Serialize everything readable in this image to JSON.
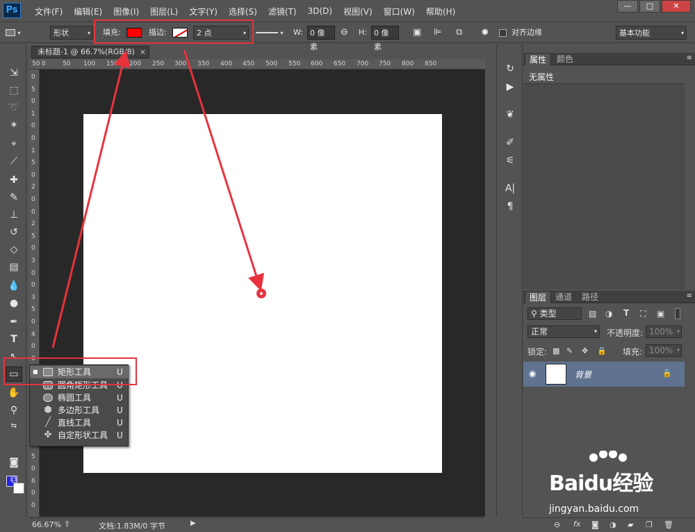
{
  "app": {
    "logo": "Ps"
  },
  "menu": [
    "文件(F)",
    "编辑(E)",
    "图像(I)",
    "图层(L)",
    "文字(Y)",
    "选择(S)",
    "滤镜(T)",
    "3D(D)",
    "视图(V)",
    "窗口(W)",
    "帮助(H)"
  ],
  "window_controls": {
    "minimize": "—",
    "maximize": "□",
    "close": "✕"
  },
  "options_bar": {
    "mode": "形状",
    "fill_label": "填充:",
    "fill_color": "#ff0000",
    "stroke_label": "描边:",
    "stroke_width": "2 点",
    "w_label": "W:",
    "w_value": "0 像素",
    "h_label": "H:",
    "h_value": "0 像素",
    "align_edges": "对齐边缘",
    "workspace": "基本功能"
  },
  "document": {
    "tab_title": "未标题-1 @ 66.7%(RGB/8)",
    "tab_close": "×",
    "ruler_top": [
      "50",
      "0",
      "50",
      "100",
      "150",
      "200",
      "250",
      "300",
      "350",
      "400",
      "450",
      "500",
      "550",
      "600",
      "650",
      "700",
      "750",
      "800",
      "850"
    ],
    "ruler_left": [
      "0",
      "5",
      "0",
      "1",
      "0",
      "0",
      "1",
      "5",
      "0",
      "2",
      "0",
      "0",
      "2",
      "5",
      "0",
      "3",
      "0",
      "0",
      "3",
      "5",
      "0",
      "4",
      "0",
      "0",
      "4",
      "5",
      "0",
      "5",
      "0",
      "0",
      "5",
      "5",
      "0",
      "6",
      "0",
      "0"
    ],
    "zoom": "66.67%",
    "doc_info": "文档:1.83M/0 字节"
  },
  "colors": {
    "foreground": "#2424e0",
    "background": "#ffffff",
    "annotation": "#e8323c"
  },
  "shape_flyout": [
    {
      "label": "矩形工具",
      "key": "U",
      "icon": "rectangle-icon",
      "selected": true
    },
    {
      "label": "圆角矩形工具",
      "key": "U",
      "icon": "rounded-rectangle-icon",
      "selected": false
    },
    {
      "label": "椭圆工具",
      "key": "U",
      "icon": "ellipse-icon",
      "selected": false
    },
    {
      "label": "多边形工具",
      "key": "U",
      "icon": "polygon-icon",
      "selected": false
    },
    {
      "label": "直线工具",
      "key": "U",
      "icon": "line-icon",
      "selected": false
    },
    {
      "label": "自定形状工具",
      "key": "U",
      "icon": "custom-shape-icon",
      "selected": false
    }
  ],
  "properties_panel": {
    "tabs": [
      "属性",
      "颜色"
    ],
    "no_properties": "无属性"
  },
  "layers_panel": {
    "tabs": [
      "图层",
      "通道",
      "路径"
    ],
    "filter": "类型",
    "blend_mode": "正常",
    "opacity_label": "不透明度:",
    "opacity_value": "100%",
    "lock_label": "锁定:",
    "fill_label": "填充:",
    "fill_value": "100%",
    "layer_name": "背景"
  },
  "watermark": {
    "brand": "Baidu经验",
    "url": "jingyan.baidu.com"
  }
}
